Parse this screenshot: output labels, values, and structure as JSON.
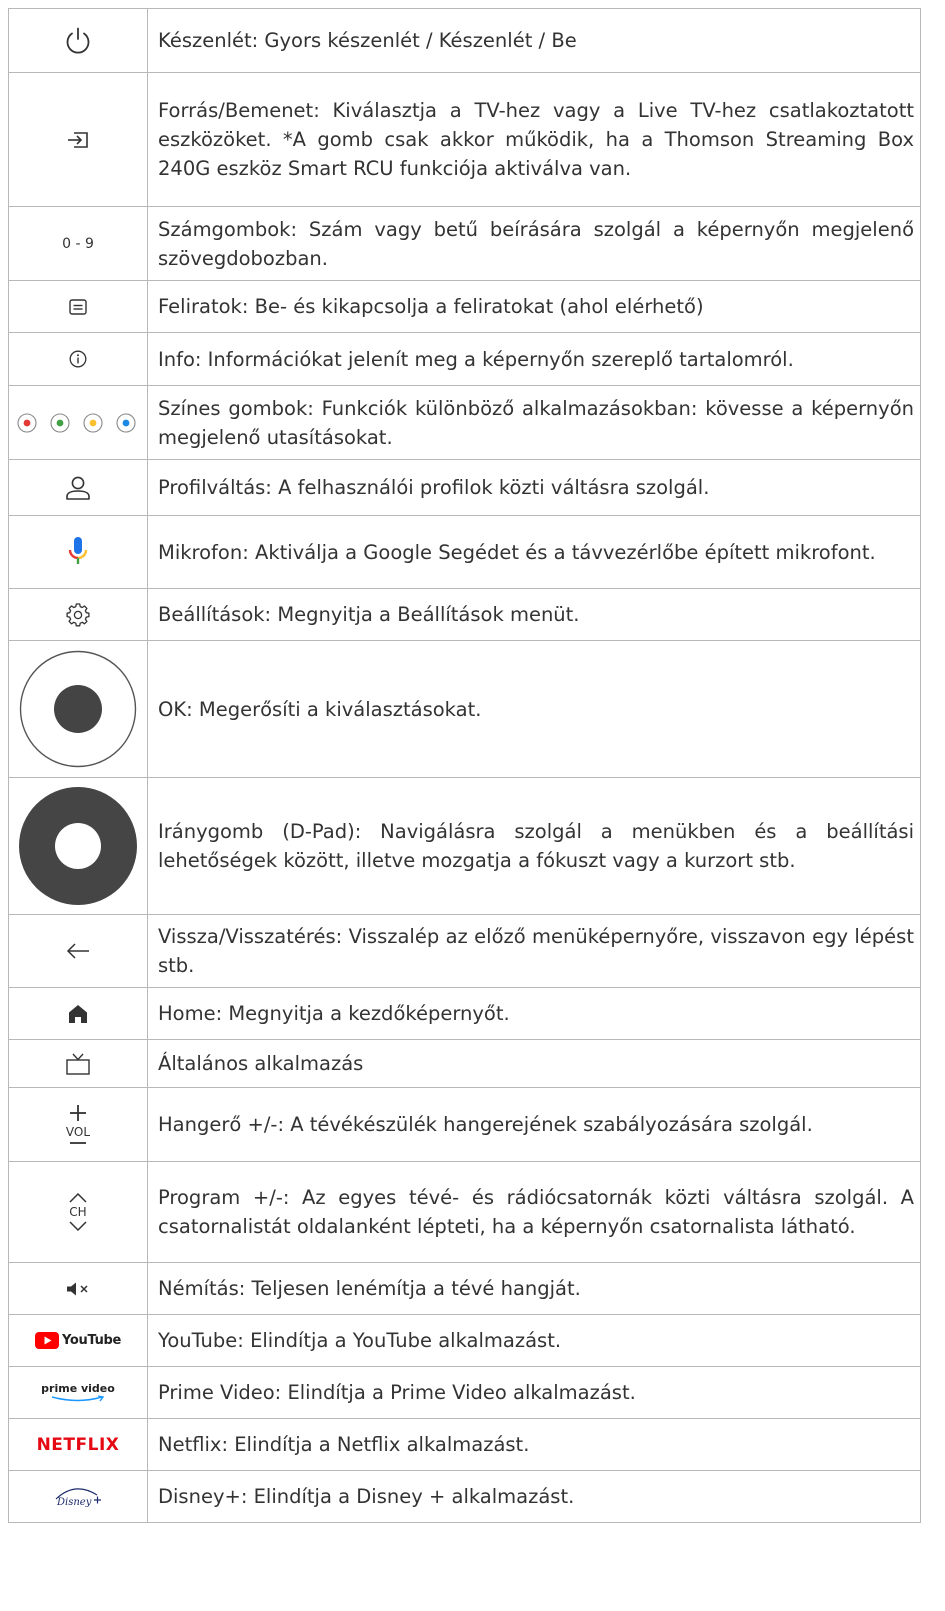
{
  "rows": [
    {
      "icon": "power-icon",
      "text": "Készenlét: Gyors készenlét / Készenlét / Be"
    },
    {
      "icon": "input-icon",
      "text": "Forrás/Bemenet: Kiválasztja a TV-hez vagy a Live TV-hez csatlakoztatott eszközöket. *A gomb csak akkor működik, ha a Thomson Streaming Box 240G eszköz Smart RCU funkciója aktiválva van."
    },
    {
      "icon": "number-keys",
      "icon_text": "0 - 9",
      "text": "Számgombok: Szám vagy betű beírására szolgál a képernyőn megjelenő szövegdobozban."
    },
    {
      "icon": "subtitles-icon",
      "text": "Feliratok: Be- és kikapcsolja a feliratokat (ahol elérhető)"
    },
    {
      "icon": "info-icon",
      "text": "Info: Információkat jelenít meg a képernyőn szereplő tartalomról."
    },
    {
      "icon": "color-buttons-icon",
      "colors": [
        "#e53935",
        "#43a047",
        "#fbc02d",
        "#1e88e5"
      ],
      "text": "Színes gombok: Funkciók különböző alkalmazásokban: kövesse a képernyőn megjelenő utasításokat."
    },
    {
      "icon": "profile-icon",
      "text": "Profilváltás: A felhasználói profilok közti váltásra szolgál."
    },
    {
      "icon": "microphone-icon",
      "text": "Mikrofon: Aktiválja a Google Segédet és a távvezérlőbe épített mikrofont."
    },
    {
      "icon": "gear-icon",
      "text": "Beállítások: Megnyitja a Beállítások menüt."
    },
    {
      "icon": "ok-button-icon",
      "text": "OK: Megerősíti a kiválasztásokat."
    },
    {
      "icon": "dpad-icon",
      "text": "Iránygomb (D-Pad): Navigálásra szolgál a menükben és a beállítási lehetőségek között, illetve mozgatja a fókuszt vagy a kurzort stb."
    },
    {
      "icon": "back-arrow-icon",
      "text": "Vissza/Visszatérés: Visszalép az előző menüképernyőre, visszavon egy lépést stb."
    },
    {
      "icon": "home-icon",
      "text": "Home: Megnyitja a kezdőképernyőt."
    },
    {
      "icon": "tv-app-icon",
      "text": "Általános alkalmazás"
    },
    {
      "icon": "volume-icon",
      "icon_text": "VOL",
      "text": "Hangerő +/-: A tévékészülék hangerejének szabályozására szolgál."
    },
    {
      "icon": "channel-icon",
      "icon_text": "CH",
      "text": "Program +/-: Az egyes tévé- és rádiócsatornák közti váltásra szolgál. A csatornalistát oldalanként lépteti, ha a képernyőn csatornalista látható."
    },
    {
      "icon": "mute-icon",
      "text": "Némítás: Teljesen lenémítja a tévé hangját."
    },
    {
      "icon": "youtube-logo",
      "icon_text": "YouTube",
      "text": "YouTube: Elindítja a YouTube alkalmazást."
    },
    {
      "icon": "prime-video-logo",
      "icon_text": "prime video",
      "text": "Prime Video: Elindítja a Prime Video alkalmazást."
    },
    {
      "icon": "netflix-logo",
      "icon_text": "NETFLIX",
      "text": "Netflix: Elindítja a Netflix alkalmazást."
    },
    {
      "icon": "disney-plus-logo",
      "text": "Disney+: Elindítja a Disney + alkalmazást."
    }
  ]
}
